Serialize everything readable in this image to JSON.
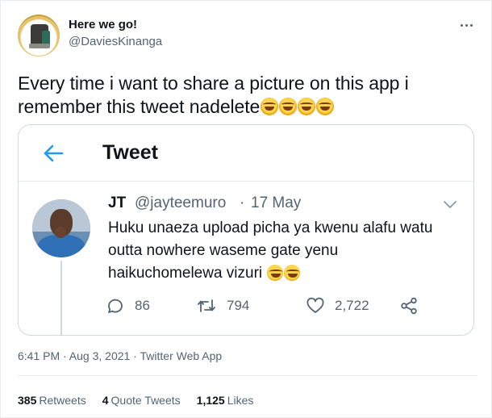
{
  "author": {
    "name": "Here we go!",
    "handle": "@DaviesKinanga"
  },
  "tweet_text": "Every time i want to share a picture on this app i remember this tweet nadelete",
  "tweet_emoji_count": 4,
  "embed": {
    "header_title": "Tweet",
    "quoted": {
      "name": "JT",
      "handle": "@jayteemuro",
      "separator": "·",
      "date": "17 May",
      "text": "Huku unaeza upload picha ya kwenu alafu watu outta nowhere waseme gate yenu haikuchomelewa vizuri",
      "emoji_count": 2,
      "actions": {
        "replies": "86",
        "retweets": "794",
        "likes": "2,722"
      }
    }
  },
  "meta": {
    "timestamp": "6:41 PM · Aug 3, 2021 · Twitter Web App"
  },
  "stats": {
    "retweets_count": "385",
    "retweets_label": "Retweets",
    "quotes_count": "4",
    "quotes_label": "Quote Tweets",
    "likes_count": "1,125",
    "likes_label": "Likes"
  },
  "colors": {
    "accent": "#1d9bf0",
    "secondary_text": "#536471",
    "border": "#cfd9de"
  },
  "icons": [
    "more-icon",
    "back-arrow-icon",
    "chevron-down-icon",
    "reply-icon",
    "retweet-icon",
    "like-icon",
    "share-icon"
  ]
}
